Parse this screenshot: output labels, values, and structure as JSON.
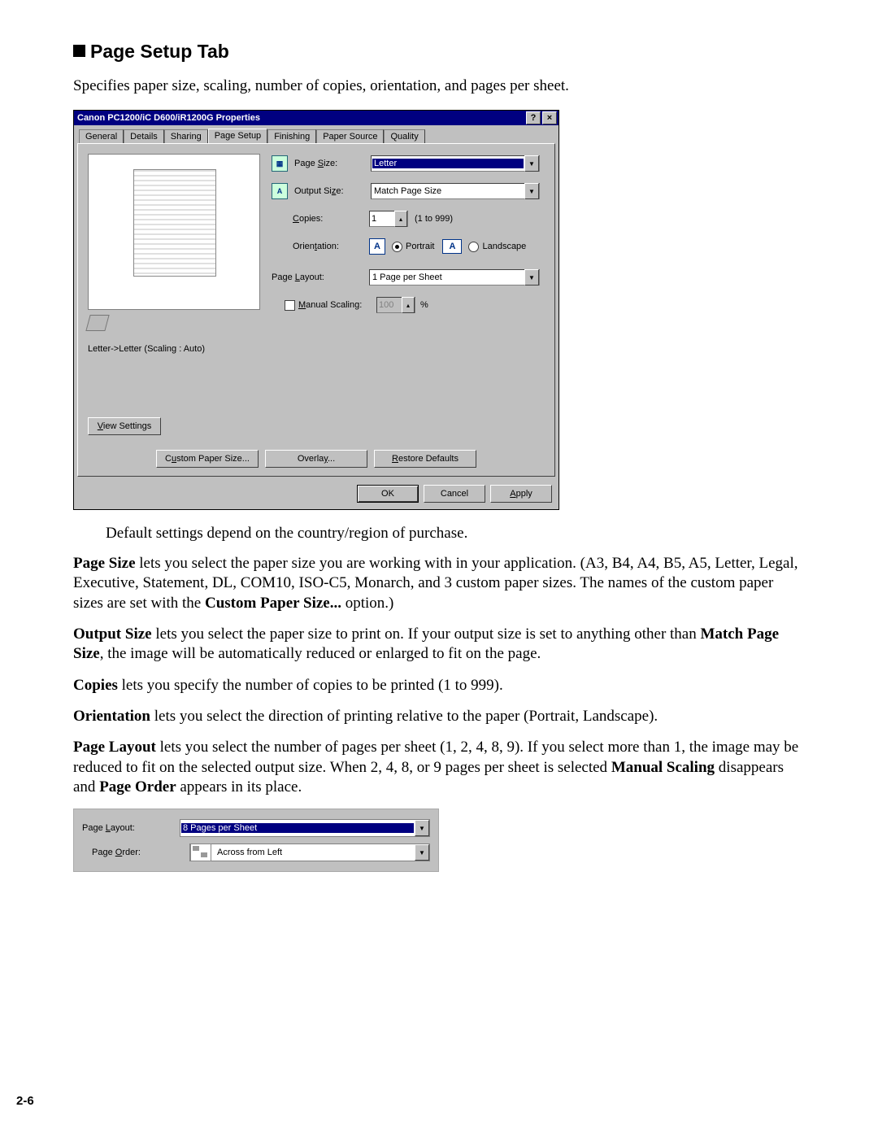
{
  "heading": "Page Setup Tab",
  "intro": "Specifies paper size, scaling, number of copies, orientation, and pages per sheet.",
  "dialog": {
    "title": "Canon PC1200/iC D600/iR1200G Properties",
    "help": "?",
    "close": "×",
    "tabs": [
      "General",
      "Details",
      "Sharing",
      "Page Setup",
      "Finishing",
      "Paper Source",
      "Quality"
    ],
    "active_tab": "Page Setup",
    "fields": {
      "page_size_label": "Page Size:",
      "page_size_value": "Letter",
      "output_size_label": "Output Size:",
      "output_size_value": "Match Page Size",
      "copies_label": "Copies:",
      "copies_value": "1",
      "copies_range": "(1 to 999)",
      "orientation_label": "Orientation:",
      "orientation_portrait": "Portrait",
      "orientation_landscape": "Landscape",
      "page_layout_label": "Page Layout:",
      "page_layout_value": "1 Page per Sheet",
      "manual_scaling_label": "Manual Scaling:",
      "manual_scaling_value": "100",
      "manual_scaling_suffix": "%"
    },
    "scaling_text": "Letter->Letter (Scaling : Auto)",
    "view_settings": "View Settings",
    "bottom": {
      "custom_paper": "Custom Paper Size...",
      "overlay": "Overlay...",
      "restore": "Restore Defaults"
    },
    "ok": "OK",
    "cancel": "Cancel",
    "apply": "Apply"
  },
  "note": "Default settings depend on the country/region of purchase.",
  "p_page_size_a": "Page Size",
  "p_page_size_b": " lets you select the paper size you are working with in your application. (A3, B4, A4, B5, A5, Letter, Legal, Executive, Statement, DL, COM10, ISO-C5, Monarch, and 3 custom paper sizes. The names of the custom paper sizes are set with the ",
  "p_page_size_c": "Custom Paper Size...",
  "p_page_size_d": " option.)",
  "p_output_a": "Output Size",
  "p_output_b": " lets you select the paper size to print on. If your output size is set to anything other than ",
  "p_output_c": "Match Page Size",
  "p_output_d": ", the image will be automatically reduced or enlarged to fit on the page.",
  "p_copies_a": "Copies",
  "p_copies_b": " lets you specify the number of copies to be printed (1 to 999).",
  "p_orient_a": "Orientation",
  "p_orient_b": " lets you select the direction of printing relative to the paper (Portrait, Landscape).",
  "p_layout_a": "Page Layout",
  "p_layout_b": " lets you select the number of pages per sheet (1, 2, 4, 8, 9). If you select more than 1, the image may be reduced to fit on the selected output size. When 2, 4, 8, or 9 pages per sheet is selected ",
  "p_layout_c": "Manual Scaling",
  "p_layout_d": " disappears and ",
  "p_layout_e": "Page Order",
  "p_layout_f": " appears in its place.",
  "mini": {
    "page_layout_label": "Page Layout:",
    "page_layout_value": "8 Pages per Sheet",
    "page_order_label": "Page Order:",
    "page_order_value": "Across from Left"
  },
  "pagenum": "2-6"
}
